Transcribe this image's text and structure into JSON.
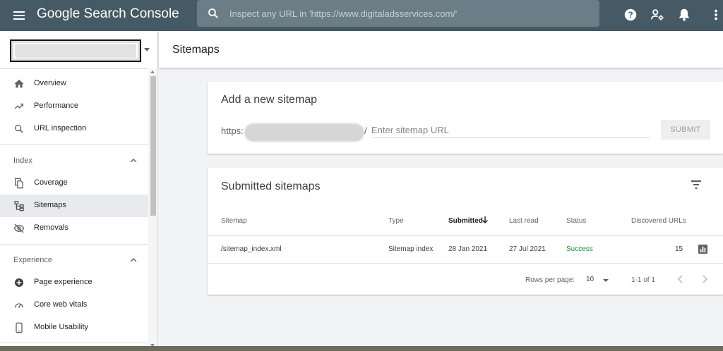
{
  "app": {
    "title": "Google Search Console",
    "search_placeholder": "Inspect any URL in 'https://www.digitaladsservices.com/'"
  },
  "icons": {
    "menu": "menu-icon",
    "search": "search-icon",
    "help": "help-icon",
    "users": "manage-users-icon",
    "notifications": "bell-icon",
    "more": "more-vert-icon"
  },
  "sidebar": {
    "items_top": [
      {
        "label": "Overview",
        "icon": "home-icon"
      },
      {
        "label": "Performance",
        "icon": "trending-up-icon"
      },
      {
        "label": "URL inspection",
        "icon": "search-icon"
      }
    ],
    "index_section": {
      "label": "Index",
      "items": [
        {
          "label": "Coverage",
          "icon": "file-copy-icon"
        },
        {
          "label": "Sitemaps",
          "icon": "sitemap-icon",
          "active": true
        },
        {
          "label": "Removals",
          "icon": "eye-off-icon"
        }
      ]
    },
    "experience_section": {
      "label": "Experience",
      "items": [
        {
          "label": "Page experience",
          "icon": "add-circle-icon"
        },
        {
          "label": "Core web vitals",
          "icon": "speed-gauge-icon"
        },
        {
          "label": "Mobile Usability",
          "icon": "smartphone-icon"
        }
      ]
    }
  },
  "page": {
    "title": "Sitemaps"
  },
  "add_sitemap": {
    "title": "Add a new sitemap",
    "url_prefix": "https:",
    "slash": "/",
    "input_placeholder": "Enter sitemap URL",
    "submit_label": "SUBMIT"
  },
  "submitted": {
    "title": "Submitted sitemaps",
    "columns": {
      "sitemap": "Sitemap",
      "type": "Type",
      "submitted": "Submitted",
      "last_read": "Last read",
      "status": "Status",
      "discovered": "Discovered URLs"
    },
    "rows": [
      {
        "sitemap": "/sitemap_index.xml",
        "type": "Sitemap index",
        "submitted": "28 Jan 2021",
        "last_read": "27 Jul 2021",
        "status": "Success",
        "discovered": "15"
      }
    ],
    "footer": {
      "rows_per_page_label": "Rows per page:",
      "rows_per_page": "10",
      "range": "1-1 of 1"
    }
  },
  "colors": {
    "topbar": "#455a64",
    "success": "#1e8e3e",
    "active_nav": "#e8eaed"
  }
}
